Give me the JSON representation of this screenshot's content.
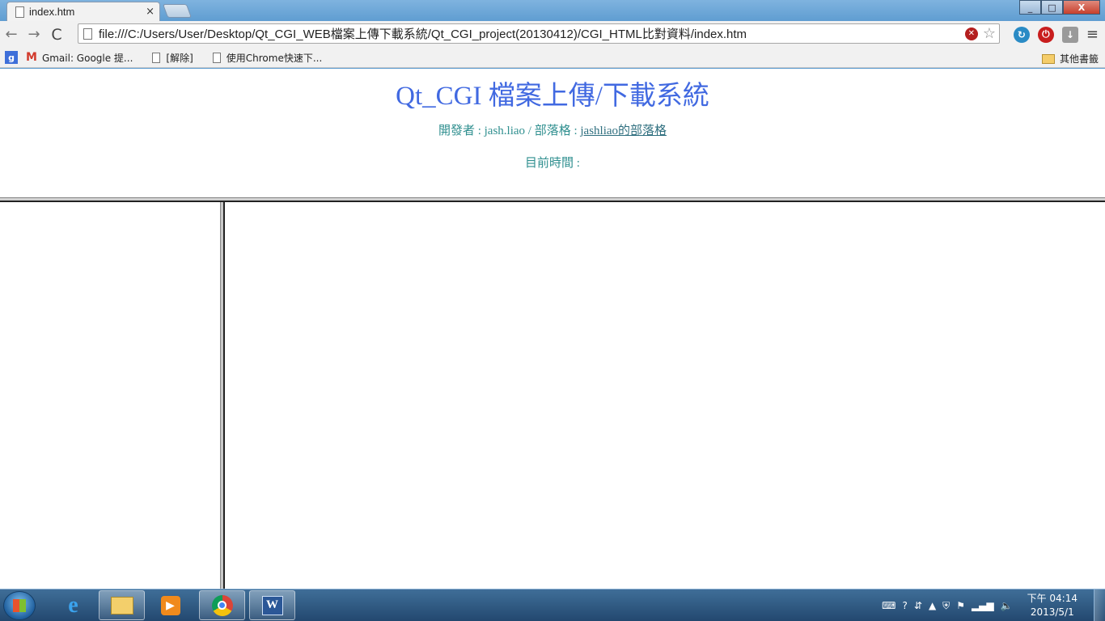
{
  "browser": {
    "tab_title": "index.htm",
    "tab_close": "×",
    "url": "file:///C:/Users/User/Desktop/Qt_CGI_WEB檔案上傳下載系統/Qt_CGI_project(20130412)/CGI_HTML比對資料/index.htm",
    "nav": {
      "back": "←",
      "forward": "→",
      "reload": "C"
    },
    "menu": "≡",
    "window_buttons": {
      "minimize": "_",
      "maximize": "□",
      "close": "X"
    }
  },
  "bookmarks": {
    "items": [
      {
        "label": "Gmail: Google 提..."
      },
      {
        "label": "[解除]"
      },
      {
        "label": "使用Chrome快速下..."
      }
    ],
    "other": "其他書籤"
  },
  "page": {
    "title": "Qt_CGI 檔案上傳/下載系統",
    "dev_prefix": "開發者 : jash.liao / 部落格 : ",
    "blog_link": "jashliao的部落格",
    "time_label": "目前時間 :"
  },
  "taskbar": {
    "clock_time": "下午 04:14",
    "clock_date": "2013/5/1"
  }
}
